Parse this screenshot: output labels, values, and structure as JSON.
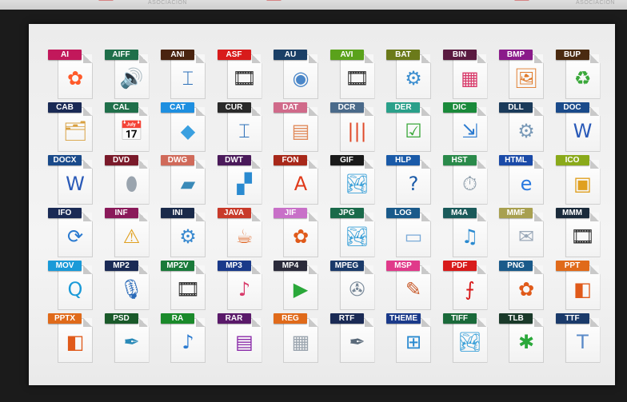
{
  "watermark": {
    "text_left": "ASOCIACIÓN",
    "text_right": "ASOCIACIÓN"
  },
  "files": [
    {
      "ext": "AI",
      "color": "#c2185b",
      "icon": "flower-icon",
      "glyph": "✿",
      "glyph_color": "#ff5a2a"
    },
    {
      "ext": "AIFF",
      "color": "#1f6f4a",
      "icon": "speaker-icon",
      "glyph": "🔊",
      "glyph_color": "#8a9aa8"
    },
    {
      "ext": "ANI",
      "color": "#4a2410",
      "icon": "text-cursor-icon",
      "glyph": "⌶",
      "glyph_color": "#2b6fb8"
    },
    {
      "ext": "ASF",
      "color": "#d81b1b",
      "icon": "film-icon",
      "glyph": "🎞",
      "glyph_color": "#2a2a2a"
    },
    {
      "ext": "AU",
      "color": "#1a3f66",
      "icon": "disc-icon",
      "glyph": "◉",
      "glyph_color": "#4a86c8"
    },
    {
      "ext": "AVI",
      "color": "#5aa21b",
      "icon": "film-icon",
      "glyph": "🎞",
      "glyph_color": "#2a2a2a"
    },
    {
      "ext": "BAT",
      "color": "#6b7a1a",
      "icon": "gear-icon",
      "glyph": "⚙",
      "glyph_color": "#3d8fd0"
    },
    {
      "ext": "BIN",
      "color": "#5a1a40",
      "icon": "cubes-icon",
      "glyph": "▦",
      "glyph_color": "#d83a6a"
    },
    {
      "ext": "BMP",
      "color": "#8a1a8a",
      "icon": "painting-icon",
      "glyph": "🖼",
      "glyph_color": "#e07a2a"
    },
    {
      "ext": "BUP",
      "color": "#4a2a10",
      "icon": "recycle-disk-icon",
      "glyph": "♻",
      "glyph_color": "#3aa83a"
    },
    {
      "ext": "CAB",
      "color": "#1a2a55",
      "icon": "zip-folder-icon",
      "glyph": "🗂",
      "glyph_color": "#d8a040"
    },
    {
      "ext": "CAL",
      "color": "#1f6f4a",
      "icon": "calendar-icon",
      "glyph": "📅",
      "glyph_color": "#5a8fc8"
    },
    {
      "ext": "CAT",
      "color": "#1e8fe0",
      "icon": "catalog-icon",
      "glyph": "◆",
      "glyph_color": "#3aa0e0"
    },
    {
      "ext": "CUR",
      "color": "#2a2a2a",
      "icon": "text-cursor-icon",
      "glyph": "⌶",
      "glyph_color": "#2b6fb8"
    },
    {
      "ext": "DAT",
      "color": "#d06a8a",
      "icon": "spreadsheet-icon",
      "glyph": "▤",
      "glyph_color": "#e08a5a"
    },
    {
      "ext": "DCR",
      "color": "#4a6a8a",
      "icon": "bars-icon",
      "glyph": "|||",
      "glyph_color": "#e04a2a"
    },
    {
      "ext": "DER",
      "color": "#2aa08a",
      "icon": "checklist-icon",
      "glyph": "☑",
      "glyph_color": "#3aa83a"
    },
    {
      "ext": "DIC",
      "color": "#1a8a3a",
      "icon": "arrows-icon",
      "glyph": "⇲",
      "glyph_color": "#2a7ad0"
    },
    {
      "ext": "DLL",
      "color": "#1a3a5a",
      "icon": "gears-icon",
      "glyph": "⚙",
      "glyph_color": "#7a9ab8"
    },
    {
      "ext": "DOC",
      "color": "#1a4a8a",
      "icon": "word-icon",
      "glyph": "W",
      "glyph_color": "#2a5ab8"
    },
    {
      "ext": "DOCX",
      "color": "#1a4a8a",
      "icon": "word-icon",
      "glyph": "W",
      "glyph_color": "#2a5ab8"
    },
    {
      "ext": "DVD",
      "color": "#7a1a2a",
      "icon": "cylinder-icon",
      "glyph": "⬮",
      "glyph_color": "#9aa4ae"
    },
    {
      "ext": "DWG",
      "color": "#d06a5a",
      "icon": "drawing-icon",
      "glyph": "▰",
      "glyph_color": "#3a8ab8"
    },
    {
      "ext": "DWT",
      "color": "#4a1a5a",
      "icon": "blocks-icon",
      "glyph": "▞",
      "glyph_color": "#2a8ad0"
    },
    {
      "ext": "FON",
      "color": "#a8281a",
      "icon": "font-letter-icon",
      "glyph": "A",
      "glyph_color": "#e03a1a"
    },
    {
      "ext": "GIF",
      "color": "#1a1a1a",
      "icon": "picture-icon",
      "glyph": "🏞",
      "glyph_color": "#3aa0d8"
    },
    {
      "ext": "HLP",
      "color": "#1a5aa8",
      "icon": "help-icon",
      "glyph": "?",
      "glyph_color": "#1a5aa8"
    },
    {
      "ext": "HST",
      "color": "#2a8a4a",
      "icon": "stopwatch-icon",
      "glyph": "⏱",
      "glyph_color": "#8a9aa8"
    },
    {
      "ext": "HTML",
      "color": "#1a4aa8",
      "icon": "browser-e-icon",
      "glyph": "e",
      "glyph_color": "#2a7ae0"
    },
    {
      "ext": "ICO",
      "color": "#8aaa1a",
      "icon": "blocks-icon",
      "glyph": "▣",
      "glyph_color": "#e0a020"
    },
    {
      "ext": "IFO",
      "color": "#1a2a55",
      "icon": "sync-disc-icon",
      "glyph": "⟳",
      "glyph_color": "#2a7ad0"
    },
    {
      "ext": "INF",
      "color": "#8a1a5a",
      "icon": "warning-icon",
      "glyph": "⚠",
      "glyph_color": "#e0a020"
    },
    {
      "ext": "INI",
      "color": "#1a2a4a",
      "icon": "gear-icon",
      "glyph": "⚙",
      "glyph_color": "#3a8ad0"
    },
    {
      "ext": "JAVA",
      "color": "#c83a2a",
      "icon": "java-cup-icon",
      "glyph": "☕",
      "glyph_color": "#e06a2a"
    },
    {
      "ext": "JIF",
      "color": "#c870c8",
      "icon": "flower-icon",
      "glyph": "✿",
      "glyph_color": "#e05a1a"
    },
    {
      "ext": "JPG",
      "color": "#1a6a4a",
      "icon": "landscape-icon",
      "glyph": "🏞",
      "glyph_color": "#3aa0d8"
    },
    {
      "ext": "LOG",
      "color": "#1a5a8a",
      "icon": "blank-doc-icon",
      "glyph": "▭",
      "glyph_color": "#7aaad8"
    },
    {
      "ext": "M4A",
      "color": "#1a5a5a",
      "icon": "music-disc-icon",
      "glyph": "♫",
      "glyph_color": "#2a8ad0"
    },
    {
      "ext": "MMF",
      "color": "#a8a050",
      "icon": "envelope-icon",
      "glyph": "✉",
      "glyph_color": "#9aa8b8"
    },
    {
      "ext": "MMM",
      "color": "#1a2a3a",
      "icon": "film-icon",
      "glyph": "🎞",
      "glyph_color": "#2a2a2a"
    },
    {
      "ext": "MOV",
      "color": "#1a9ad8",
      "icon": "quicktime-icon",
      "glyph": "Q",
      "glyph_color": "#1a9ad8"
    },
    {
      "ext": "MP2",
      "color": "#1a2a55",
      "icon": "microphone-icon",
      "glyph": "🎙",
      "glyph_color": "#2a6ab8"
    },
    {
      "ext": "MP2V",
      "color": "#1a7a3a",
      "icon": "film-icon",
      "glyph": "🎞",
      "glyph_color": "#2a2a2a"
    },
    {
      "ext": "MP3",
      "color": "#1a3a8a",
      "icon": "phone-disc-icon",
      "glyph": "♪",
      "glyph_color": "#d83a6a"
    },
    {
      "ext": "MP4",
      "color": "#2a2a3a",
      "icon": "film-play-icon",
      "glyph": "▶",
      "glyph_color": "#2aa83a"
    },
    {
      "ext": "MPEG",
      "color": "#1a3a6a",
      "icon": "film-reel-icon",
      "glyph": "✇",
      "glyph_color": "#7a8a9a"
    },
    {
      "ext": "MSP",
      "color": "#e03a8a",
      "icon": "brushes-icon",
      "glyph": "✎",
      "glyph_color": "#c85a2a"
    },
    {
      "ext": "PDF",
      "color": "#d81b1b",
      "icon": "acrobat-icon",
      "glyph": "⨍",
      "glyph_color": "#d81b1b"
    },
    {
      "ext": "PNG",
      "color": "#1a5a8a",
      "icon": "flower-icon",
      "glyph": "✿",
      "glyph_color": "#e05a1a"
    },
    {
      "ext": "PPT",
      "color": "#e06a1a",
      "icon": "presentation-icon",
      "glyph": "◧",
      "glyph_color": "#e05a1a"
    },
    {
      "ext": "PPTX",
      "color": "#e06a1a",
      "icon": "presentation-icon",
      "glyph": "◧",
      "glyph_color": "#e05a1a"
    },
    {
      "ext": "PSD",
      "color": "#1a5a2a",
      "icon": "feather-icon",
      "glyph": "✒",
      "glyph_color": "#2a8ab8"
    },
    {
      "ext": "RA",
      "color": "#1a8a2a",
      "icon": "audio-player-icon",
      "glyph": "♪",
      "glyph_color": "#2a7ad0"
    },
    {
      "ext": "RAR",
      "color": "#5a1a6a",
      "icon": "books-stack-icon",
      "glyph": "▤",
      "glyph_color": "#8a2aa8"
    },
    {
      "ext": "REG",
      "color": "#e06a1a",
      "icon": "registry-icon",
      "glyph": "▦",
      "glyph_color": "#9aa4ae"
    },
    {
      "ext": "RTF",
      "color": "#1a2a55",
      "icon": "pen-doc-icon",
      "glyph": "✒",
      "glyph_color": "#5a6a7a"
    },
    {
      "ext": "THEME",
      "color": "#1a3a8a",
      "icon": "windows-theme-icon",
      "glyph": "⊞",
      "glyph_color": "#2a8ad0"
    },
    {
      "ext": "TIFF",
      "color": "#1a6a3a",
      "icon": "landscape-icon",
      "glyph": "🏞",
      "glyph_color": "#3aa0d8"
    },
    {
      "ext": "TLB",
      "color": "#1a3a2a",
      "icon": "person-icon",
      "glyph": "✱",
      "glyph_color": "#2aa83a"
    },
    {
      "ext": "TTF",
      "color": "#1a3a6a",
      "icon": "truetype-icon",
      "glyph": "T",
      "glyph_color": "#5a8ac8"
    }
  ]
}
